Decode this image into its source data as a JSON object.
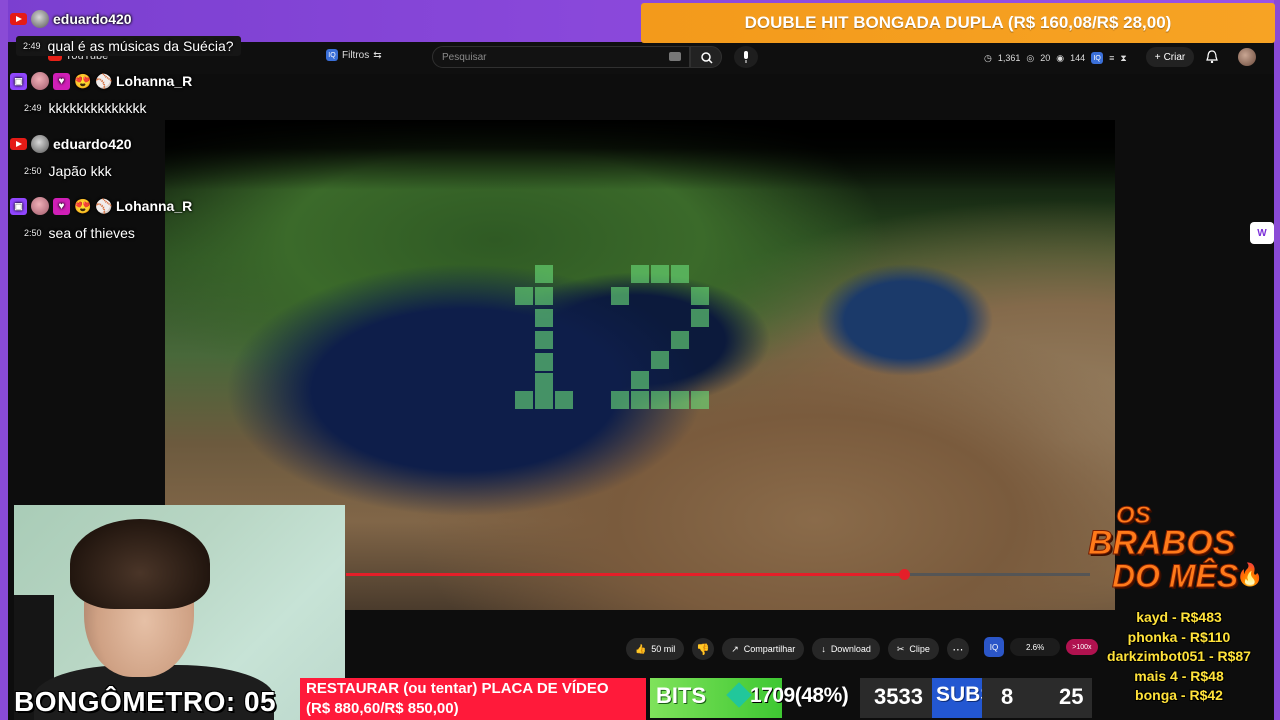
{
  "chat": {
    "messages": [
      {
        "platform": "youtube",
        "user": "eduardo420",
        "time": "2:49",
        "text": "qual é as músicas da Suécia?"
      },
      {
        "platform": "twitch",
        "user": "Lohanna_R",
        "time": "2:49",
        "text": "kkkkkkkkkkkkkk"
      },
      {
        "platform": "youtube",
        "user": "eduardo420",
        "time": "2:50",
        "text": "Japão kkk"
      },
      {
        "platform": "twitch",
        "user": "Lohanna_R",
        "time": "2:50",
        "text": "sea of thieves"
      }
    ]
  },
  "goal_top": {
    "text": "DOUBLE HIT BONGADA DUPLA (R$ 160,08/R$ 28,00)"
  },
  "youtube": {
    "logo": "YouTube",
    "filters_label": "Filtros",
    "search_placeholder": "Pesquisar",
    "stats": {
      "s1": "1,361",
      "s2": "20",
      "s3": "144"
    },
    "create_label": "Criar",
    "like_count": "50 mil",
    "share_label": "Compartilhar",
    "download_label": "Download",
    "clip_label": "Clipe",
    "iq_percent": "2.6%",
    "iq_hot": ">100x",
    "progress": 0.75
  },
  "bongometro": {
    "label": "BONGÔMETRO: 05"
  },
  "restore_goal": {
    "line1": "RESTAURAR (ou tentar) PLACA DE VÍDEO",
    "line2": "(R$ 880,60/R$ 850,00)"
  },
  "bits": {
    "label": "BITS",
    "value": "1709(48%)",
    "count": "3533"
  },
  "subs": {
    "label": "SUBS",
    "current": "8",
    "goal": "25"
  },
  "brabos": {
    "line1": "OS",
    "line2": "BRABOS",
    "line3": "DO MÊS"
  },
  "donors": [
    "kayd - R$483",
    "phonka - R$110",
    "darkzimbot051 - R$87",
    "mais 4 - R$48",
    "bonga - R$42"
  ],
  "colors": {
    "accent_purple": "#8a4bd6",
    "goal_orange": "#f39a1b",
    "restore_red": "#ff1a3a",
    "bits_green": "#3ec832",
    "subs_blue": "#2357d1",
    "donor_yellow": "#ffe23a"
  }
}
